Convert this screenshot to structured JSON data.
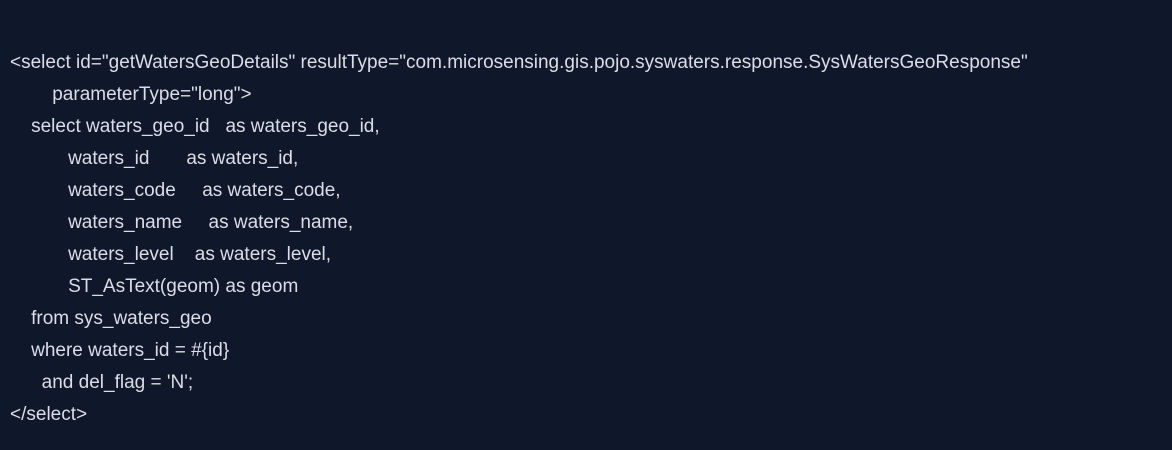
{
  "colors": {
    "background": "#0f172a",
    "text": "#d9dee7"
  },
  "code": {
    "lines": [
      "<select id=\"getWatersGeoDetails\" resultType=\"com.microsensing.gis.pojo.syswaters.response.SysWatersGeoResponse\"",
      "        parameterType=\"long\">",
      "    select waters_geo_id   as waters_geo_id,",
      "           waters_id       as waters_id,",
      "           waters_code     as waters_code,",
      "           waters_name     as waters_name,",
      "           waters_level    as waters_level,",
      "           ST_AsText(geom) as geom",
      "    from sys_waters_geo",
      "    where waters_id = #{id}",
      "      and del_flag = 'N';",
      "</select>"
    ]
  }
}
